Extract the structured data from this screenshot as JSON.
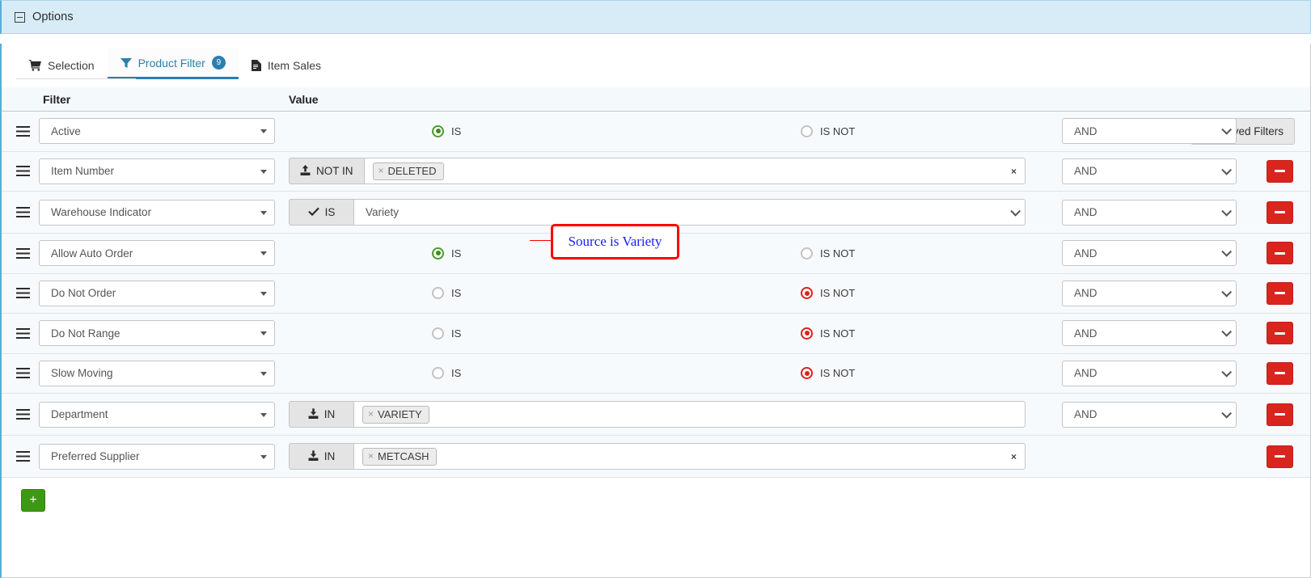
{
  "window": {
    "options_label": "Options",
    "collapse_icon": "minus-box-icon"
  },
  "tabs": [
    {
      "label": "Selection",
      "icon": "shopping-cart-icon",
      "active": false,
      "badge": ""
    },
    {
      "label": "Product Filter",
      "icon": "funnel-icon",
      "active": true,
      "badge": "9"
    },
    {
      "label": "Item Sales",
      "icon": "document-icon",
      "active": false,
      "badge": ""
    }
  ],
  "toolbar": {
    "saved_filters_label": "Saved Filters",
    "saved_filters_icon": "eye-icon"
  },
  "table": {
    "headers": {
      "filter": "Filter",
      "value": "Value"
    },
    "rows": [
      {
        "filter": "Active",
        "type": "radio",
        "is_label": "IS",
        "is_not_label": "IS NOT",
        "selected": "IS",
        "conjunction": "AND"
      },
      {
        "filter": "Item Number",
        "type": "tags",
        "operator": "NOT IN",
        "operator_icon": "upload-icon",
        "tags": [
          "DELETED"
        ],
        "clear_label": "×",
        "has_clear": true,
        "conjunction": "AND"
      },
      {
        "filter": "Warehouse Indicator",
        "type": "select",
        "operator": "IS",
        "operator_icon": "check-icon",
        "value": "Variety",
        "conjunction": "AND"
      },
      {
        "filter": "Allow Auto Order",
        "type": "radio",
        "is_label": "IS",
        "is_not_label": "IS NOT",
        "selected": "IS",
        "conjunction": "AND"
      },
      {
        "filter": "Do Not Order",
        "type": "radio",
        "is_label": "IS",
        "is_not_label": "IS NOT",
        "selected": "IS NOT",
        "conjunction": "AND"
      },
      {
        "filter": "Do Not Range",
        "type": "radio",
        "is_label": "IS",
        "is_not_label": "IS NOT",
        "selected": "IS NOT",
        "conjunction": "AND"
      },
      {
        "filter": "Slow Moving",
        "type": "radio",
        "is_label": "IS",
        "is_not_label": "IS NOT",
        "selected": "IS NOT",
        "conjunction": "AND"
      },
      {
        "filter": "Department",
        "type": "tags",
        "operator": "IN",
        "operator_icon": "download-icon",
        "tags": [
          "VARIETY"
        ],
        "clear_label": "×",
        "has_clear": false,
        "conjunction": "AND"
      },
      {
        "filter": "Preferred Supplier",
        "type": "tags",
        "operator": "IN",
        "operator_icon": "download-icon",
        "tags": [
          "METCASH"
        ],
        "clear_label": "×",
        "has_clear": true,
        "conjunction": null
      }
    ],
    "add_row_label": "+",
    "remove_row_icon": "minus-icon"
  },
  "annotation": {
    "text": "Source is Variety",
    "box_color": "#ff0000",
    "text_color": "#1a1aff"
  },
  "colors": {
    "accent": "#2a7faf",
    "header_bg": "#d7ecf7",
    "radio_on": "#3e8e1f",
    "radio_not": "#e02020",
    "delete": "#d9251d",
    "add": "#3d9912"
  }
}
